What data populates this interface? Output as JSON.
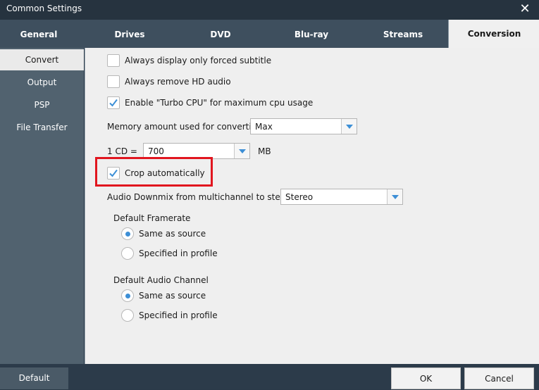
{
  "window": {
    "title": "Common Settings",
    "close_icon": "close-icon"
  },
  "tabs": [
    {
      "label": "General"
    },
    {
      "label": "Drives"
    },
    {
      "label": "DVD"
    },
    {
      "label": "Blu-ray"
    },
    {
      "label": "Streams"
    },
    {
      "label": "Conversion",
      "active": true
    }
  ],
  "sidebar": {
    "items": [
      {
        "label": "Convert",
        "active": true
      },
      {
        "label": "Output"
      },
      {
        "label": "PSP"
      },
      {
        "label": "File Transfer"
      }
    ]
  },
  "convert": {
    "forced_subtitle": {
      "label": "Always display only forced subtitle",
      "checked": false
    },
    "remove_hd_audio": {
      "label": "Always remove HD audio",
      "checked": false
    },
    "turbo_cpu": {
      "label": "Enable \"Turbo CPU\" for maximum cpu usage",
      "checked": true
    },
    "memory": {
      "label": "Memory amount used for converting",
      "value": "Max"
    },
    "cd_size": {
      "label": "1 CD =",
      "value": "700",
      "unit": "MB"
    },
    "crop_auto": {
      "label": "Crop automatically",
      "checked": true
    },
    "downmix": {
      "label": "Audio Downmix from multichannel to stereo",
      "value": "Stereo"
    },
    "framerate": {
      "heading": "Default Framerate",
      "options": [
        {
          "label": "Same as source",
          "selected": true
        },
        {
          "label": "Specified in profile",
          "selected": false
        }
      ]
    },
    "audio_channel": {
      "heading": "Default Audio Channel",
      "options": [
        {
          "label": "Same as source",
          "selected": true
        },
        {
          "label": "Specified in profile",
          "selected": false
        }
      ]
    }
  },
  "footer": {
    "default_label": "Default",
    "ok_label": "OK",
    "cancel_label": "Cancel"
  },
  "colors": {
    "highlight": "#e1161f",
    "checkmark": "#3d8fd6",
    "tab_bar": "#3e4f5e",
    "sidebar": "#51626f"
  }
}
